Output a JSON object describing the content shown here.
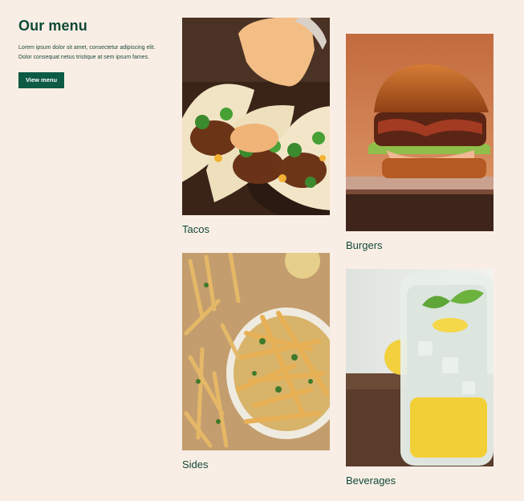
{
  "intro": {
    "title": "Our menu",
    "description": "Lorem ipsum dolor sit amet, consectetur adipiscing elit. Dolor consequat netus tristique at sem ipsum fames.",
    "button_label": "View menu"
  },
  "menu": {
    "items": [
      {
        "label": "Tacos",
        "image": "tacos-photo"
      },
      {
        "label": "Burgers",
        "image": "burger-photo"
      },
      {
        "label": "Sides",
        "image": "fries-photo"
      },
      {
        "label": "Beverages",
        "image": "lemonade-photo"
      }
    ]
  },
  "colors": {
    "background": "#f9eee6",
    "text": "#0e4a35",
    "button": "#0e5b44"
  }
}
